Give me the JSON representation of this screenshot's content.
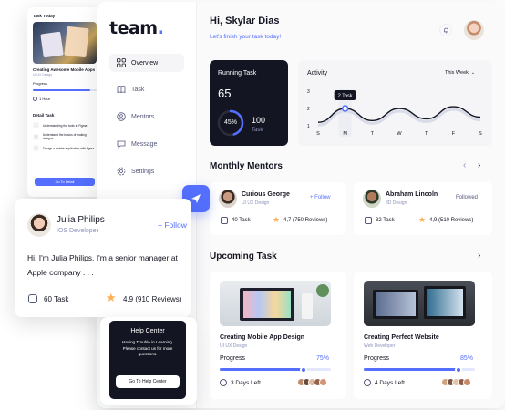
{
  "brand": {
    "name": "team",
    "dot": "."
  },
  "sidebar": {
    "items": [
      {
        "label": "Overview",
        "icon": "overview-icon"
      },
      {
        "label": "Task",
        "icon": "book-icon"
      },
      {
        "label": "Mentors",
        "icon": "user-octagon-icon"
      },
      {
        "label": "Message",
        "icon": "message-icon"
      },
      {
        "label": "Settings",
        "icon": "settings-icon"
      }
    ]
  },
  "header": {
    "greeting": "Hi, Skylar Dias",
    "subtitle": "Let's finish your task today!"
  },
  "running_task": {
    "title": "Running Task",
    "count": "65",
    "percent": "45%",
    "percent_value": 45,
    "total": "100",
    "total_label": "Task"
  },
  "activity": {
    "title": "Activity",
    "range": "This Week",
    "tooltip": "2 Task",
    "days": [
      "S",
      "M",
      "T",
      "W",
      "T",
      "F",
      "S"
    ],
    "yticks": [
      "3",
      "2",
      "1"
    ]
  },
  "chart_data": {
    "type": "line",
    "title": "Activity",
    "categories": [
      "S",
      "M",
      "T",
      "W",
      "T",
      "F",
      "S"
    ],
    "values": [
      1.2,
      2.0,
      1.3,
      2.0,
      1.4,
      2.1,
      1.5
    ],
    "ylim": [
      1,
      3
    ],
    "highlight": {
      "category": "M",
      "label": "2 Task"
    }
  },
  "monthly_mentors": {
    "title": "Monthly Mentors",
    "items": [
      {
        "name": "Curious George",
        "role": "UI UX Design",
        "action": "+ Follow",
        "tasks": "40 Task",
        "rating": "4,7 (750 Reviews)"
      },
      {
        "name": "Abraham Lincoln",
        "role": "3D Design",
        "action": "Followed",
        "tasks": "32 Task",
        "rating": "4,9 (510 Reviews)"
      }
    ]
  },
  "upcoming_task": {
    "title": "Upcoming Task",
    "items": [
      {
        "title": "Creating Mobile App Design",
        "category": "UI UX Design",
        "progress_label": "Progress",
        "progress": "75%",
        "progress_value": 75,
        "days_left": "3 Days Left"
      },
      {
        "title": "Creating Perfect Website",
        "category": "Web Developer",
        "progress_label": "Progress",
        "progress": "85%",
        "progress_value": 85,
        "days_left": "4 Days Left"
      }
    ]
  },
  "profile_card": {
    "name": "Julia Philips",
    "role": "IOS Developer",
    "action": "+ Follow",
    "bio": "Hi, I'm Julia Philips. I'm a senior manager at Apple company . . .",
    "tasks": "60 Task",
    "rating": "4,9 (910 Reviews)"
  },
  "task_today": {
    "title": "Task Today",
    "task_name": "Creating Awesome Mobile Apps",
    "category": "UI UX Design",
    "progress_label": "Progress",
    "progress_value": 90,
    "time": "1 Hour",
    "detail_title": "Detail Task",
    "steps": [
      {
        "n": "1",
        "text": "Understanding the tools in Figma"
      },
      {
        "n": "2",
        "text": "Understand the basics of making designs"
      },
      {
        "n": "3",
        "text": "Design a mobile application with figma"
      }
    ],
    "button": "Go To Detail"
  },
  "help_center": {
    "title": "Help Center",
    "text": "Having Trouble in Learning. Please contact us for more questions.",
    "button": "Go To Help Center"
  },
  "colors": {
    "accent": "#546FFF",
    "dark": "#141522",
    "muted": "#8E92BC",
    "star": "#FFB054"
  }
}
